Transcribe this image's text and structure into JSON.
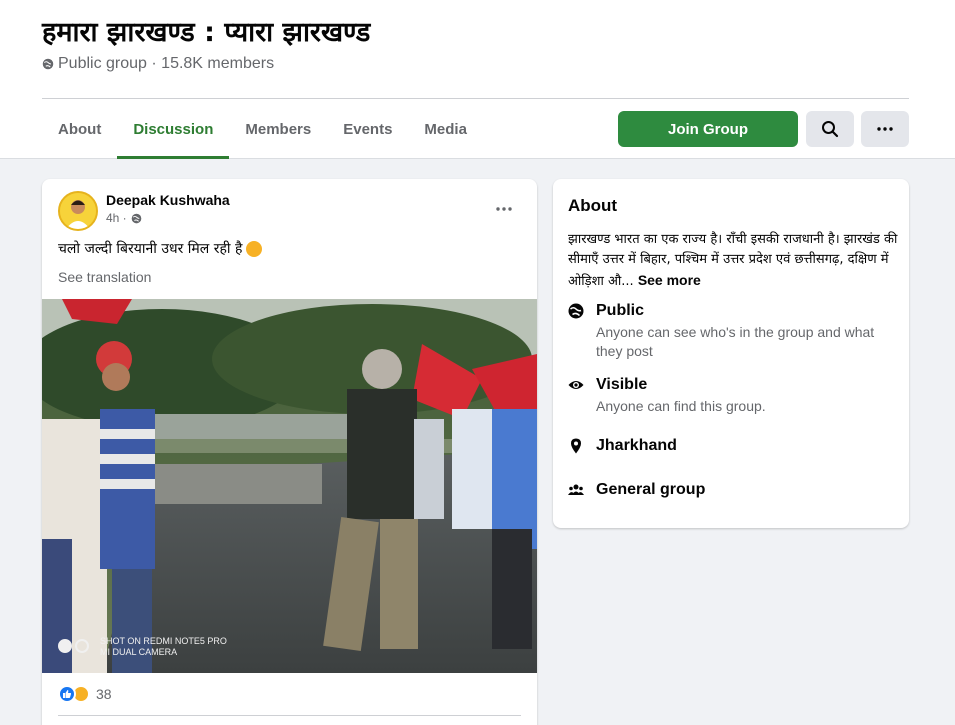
{
  "group": {
    "title": "हमारा झारखण्ड : प्यारा झारखण्ड",
    "meta": "Public group · 15.8K members",
    "join_label": "Join Group"
  },
  "tabs": [
    {
      "label": "About",
      "active": false
    },
    {
      "label": "Discussion",
      "active": true
    },
    {
      "label": "Members",
      "active": false
    },
    {
      "label": "Events",
      "active": false
    },
    {
      "label": "Media",
      "active": false
    }
  ],
  "post": {
    "author": "Deepak Kushwaha",
    "time": "4h ·",
    "text": "चलो जल्दी बिरयानी उधर मिल रही है",
    "see_translation": "See translation",
    "watermark_line1": "SHOT ON REDMI NOTE5 PRO",
    "watermark_line2": "MI DUAL CAMERA",
    "reaction_count": "38"
  },
  "about": {
    "heading": "About",
    "description": "झारखण्ड भारत का एक राज्य है। राँची इसकी राजधानी है। झारखंड की सीमाएँ उत्तर में बिहार, पश्चिम में उत्तर प्रदेश एवं छत्तीसगढ़, दक्षिण में ओड़िशा औ...",
    "see_more": "See more",
    "items": [
      {
        "icon": "globe-icon",
        "title": "Public",
        "sub": "Anyone can see who's in the group and what they post"
      },
      {
        "icon": "eye-icon",
        "title": "Visible",
        "sub": "Anyone can find this group."
      },
      {
        "icon": "location-pin-icon",
        "title": "Jharkhand",
        "sub": ""
      },
      {
        "icon": "people-icon",
        "title": "General group",
        "sub": ""
      }
    ]
  },
  "colors": {
    "accent": "#2e8b3f",
    "tab_active": "#2e7d32",
    "background": "#f0f2f5",
    "secondary_text": "#65676b"
  }
}
